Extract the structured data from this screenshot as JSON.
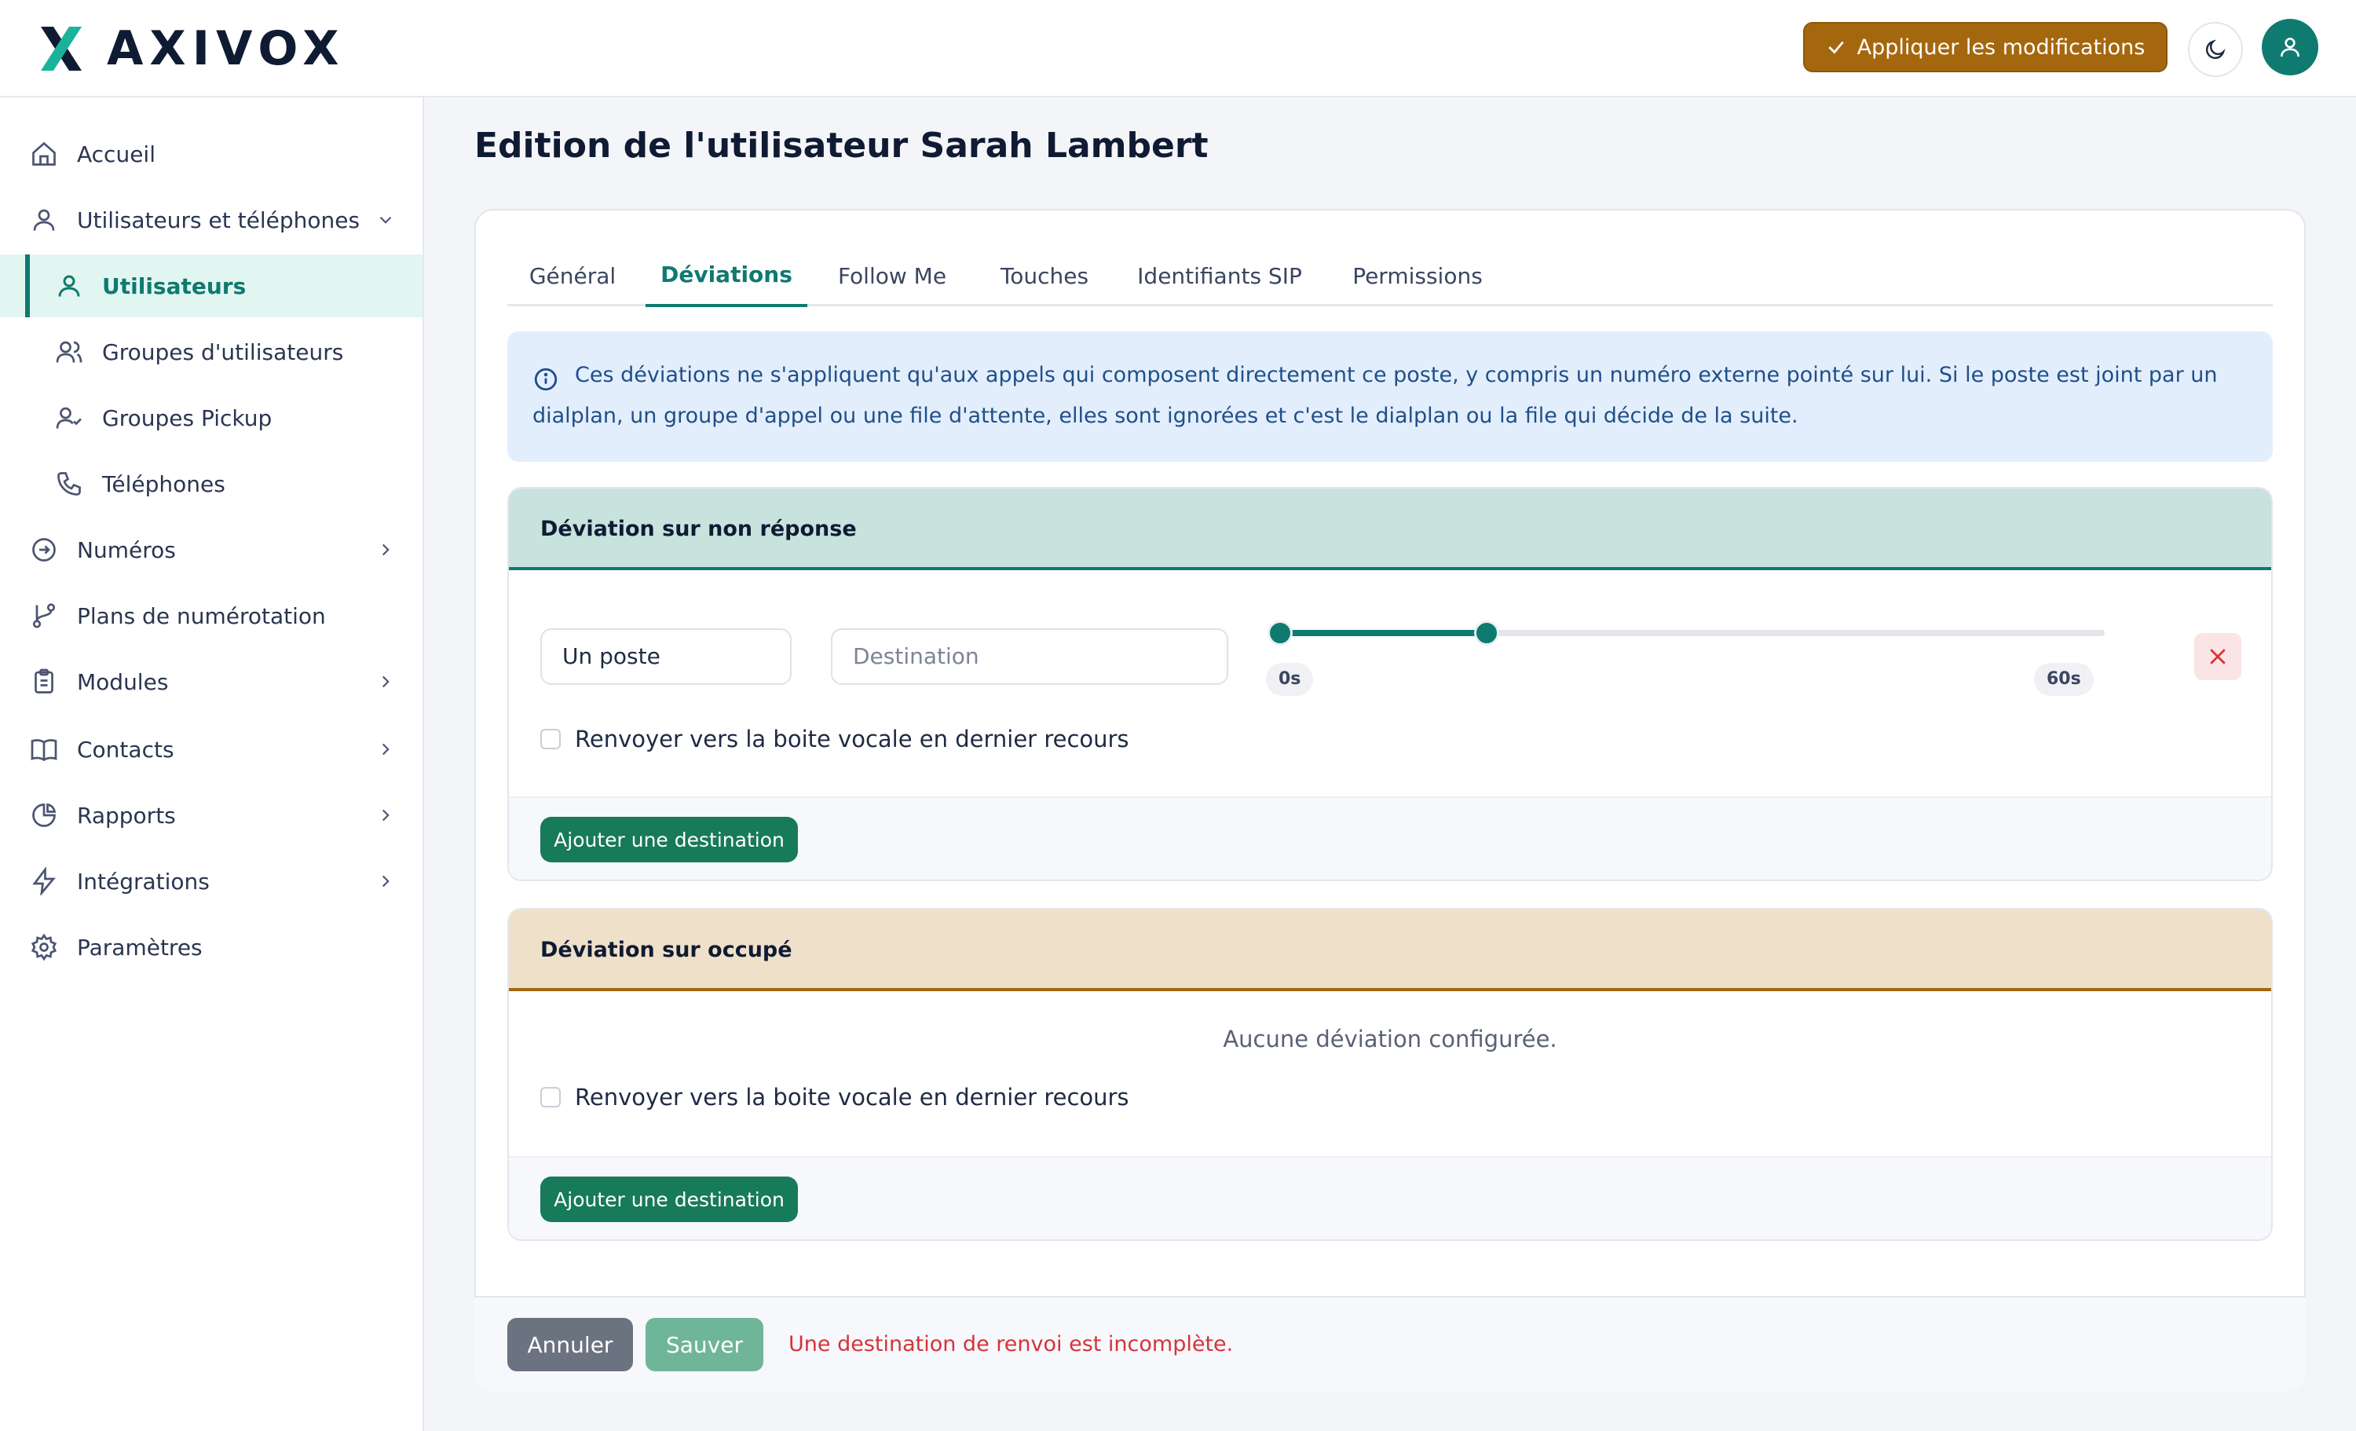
{
  "app": {
    "brand": "AXIVOX"
  },
  "header": {
    "apply_label": "Appliquer les modifications",
    "apply_icon": "check-icon",
    "theme_icon": "moon-icon",
    "user_icon": "user-icon",
    "apply_color": "#a5670e",
    "accent_color": "#0f7a70"
  },
  "sidebar": {
    "items": [
      {
        "label": "Accueil",
        "icon": "home-icon"
      },
      {
        "label": "Utilisateurs et téléphones",
        "icon": "user-icon",
        "expanded": true
      },
      {
        "label": "Utilisateurs",
        "icon": "user-icon",
        "active": true
      },
      {
        "label": "Groupes d'utilisateurs",
        "icon": "users-icon"
      },
      {
        "label": "Groupes Pickup",
        "icon": "user-check-icon"
      },
      {
        "label": "Téléphones",
        "icon": "phone-icon"
      },
      {
        "label": "Numéros",
        "icon": "arrow-circle-icon"
      },
      {
        "label": "Plans de numérotation",
        "icon": "git-branch-icon"
      },
      {
        "label": "Modules",
        "icon": "clipboard-icon"
      },
      {
        "label": "Contacts",
        "icon": "book-icon"
      },
      {
        "label": "Rapports",
        "icon": "pie-chart-icon"
      },
      {
        "label": "Intégrations",
        "icon": "bolt-icon"
      },
      {
        "label": "Paramètres",
        "icon": "gear-icon"
      }
    ]
  },
  "main": {
    "title": "Edition de l'utilisateur Sarah Lambert",
    "tabs": [
      {
        "label": "Général"
      },
      {
        "label": "Déviations",
        "active": true
      },
      {
        "label": "Follow Me"
      },
      {
        "label": "Touches"
      },
      {
        "label": "Identifiants SIP"
      },
      {
        "label": "Permissions"
      }
    ],
    "info": "Ces déviations ne s'appliquent qu'aux appels qui composent directement ce poste, y compris un numéro externe pointé sur lui. Si le poste est joint par un dialplan, un groupe d'appel ou une file d'attente, elles sont ignorées et c'est le dialplan ou la file qui décide de la suite.",
    "no_answer": {
      "title": "Déviation sur non réponse",
      "header_color": "#c8e2dd",
      "type_value": "Un poste",
      "destination_placeholder": "Destination",
      "slider_min_label": "0s",
      "slider_max_label": "60s",
      "slider_start": 0,
      "slider_end": 15,
      "slider_max": 60,
      "voicemail_label": "Renvoyer vers la boite vocale en dernier recours",
      "add_label": "Ajouter une destination"
    },
    "busy": {
      "title": "Déviation sur occupé",
      "header_color": "#efe0c9",
      "empty": "Aucune déviation configurée.",
      "voicemail_label": "Renvoyer vers la boite vocale en dernier recours",
      "add_label": "Ajouter une destination"
    },
    "footer": {
      "cancel_label": "Annuler",
      "save_label": "Sauver",
      "error": "Une destination de renvoi est incomplète."
    }
  }
}
